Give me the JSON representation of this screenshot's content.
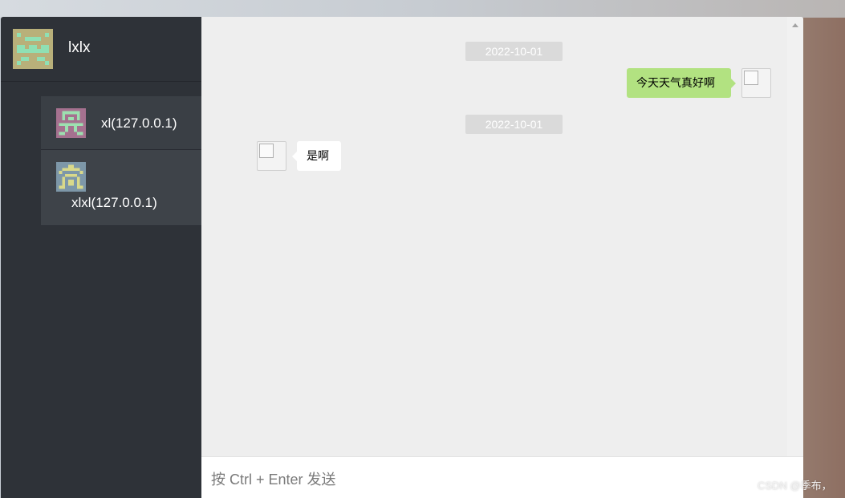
{
  "current_user": {
    "name": "lxlx",
    "avatar_icon": "identicon-avatar-icon"
  },
  "contacts": [
    {
      "name": "xl(127.0.0.1)",
      "avatar_icon": "identicon-avatar-icon"
    },
    {
      "name": "xlxl(127.0.0.1)",
      "avatar_icon": "identicon-avatar-icon"
    }
  ],
  "messages": [
    {
      "date": "2022-10-01",
      "direction": "sent",
      "text": "今天天气真好啊"
    },
    {
      "date": "2022-10-01",
      "direction": "received",
      "text": "是啊"
    }
  ],
  "composer": {
    "placeholder": "按 Ctrl + Enter 发送"
  },
  "watermark": "CSDN @季布，",
  "colors": {
    "sidebar": "#2e3238",
    "contact_bg": "#3a3f45",
    "chat_bg": "#eeeeee",
    "sent_bubble": "#b2e281",
    "received_bubble": "#ffffff",
    "date_chip": "#dadada"
  }
}
